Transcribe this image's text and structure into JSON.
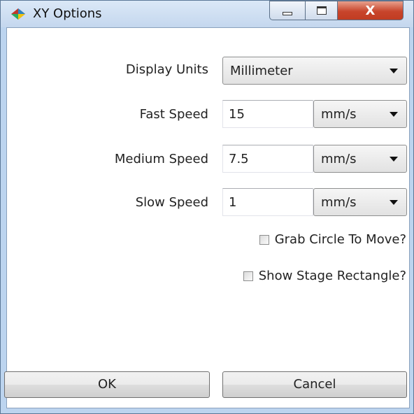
{
  "window": {
    "title": "XY Options",
    "icon": "app-diamond-icon",
    "close_glyph": "X"
  },
  "form": {
    "display_units": {
      "label": "Display Units",
      "value": "Millimeter"
    },
    "fast_speed": {
      "label": "Fast Speed",
      "value": "15",
      "unit": "mm/s"
    },
    "medium_speed": {
      "label": "Medium Speed",
      "value": "7.5",
      "unit": "mm/s"
    },
    "slow_speed": {
      "label": "Slow Speed",
      "value": "1",
      "unit": "mm/s"
    },
    "grab_circle": {
      "label": "Grab Circle To Move?",
      "checked": false
    },
    "show_stage": {
      "label": "Show Stage Rectangle?",
      "checked": false
    }
  },
  "buttons": {
    "ok_label": "OK",
    "cancel_label": "Cancel"
  }
}
